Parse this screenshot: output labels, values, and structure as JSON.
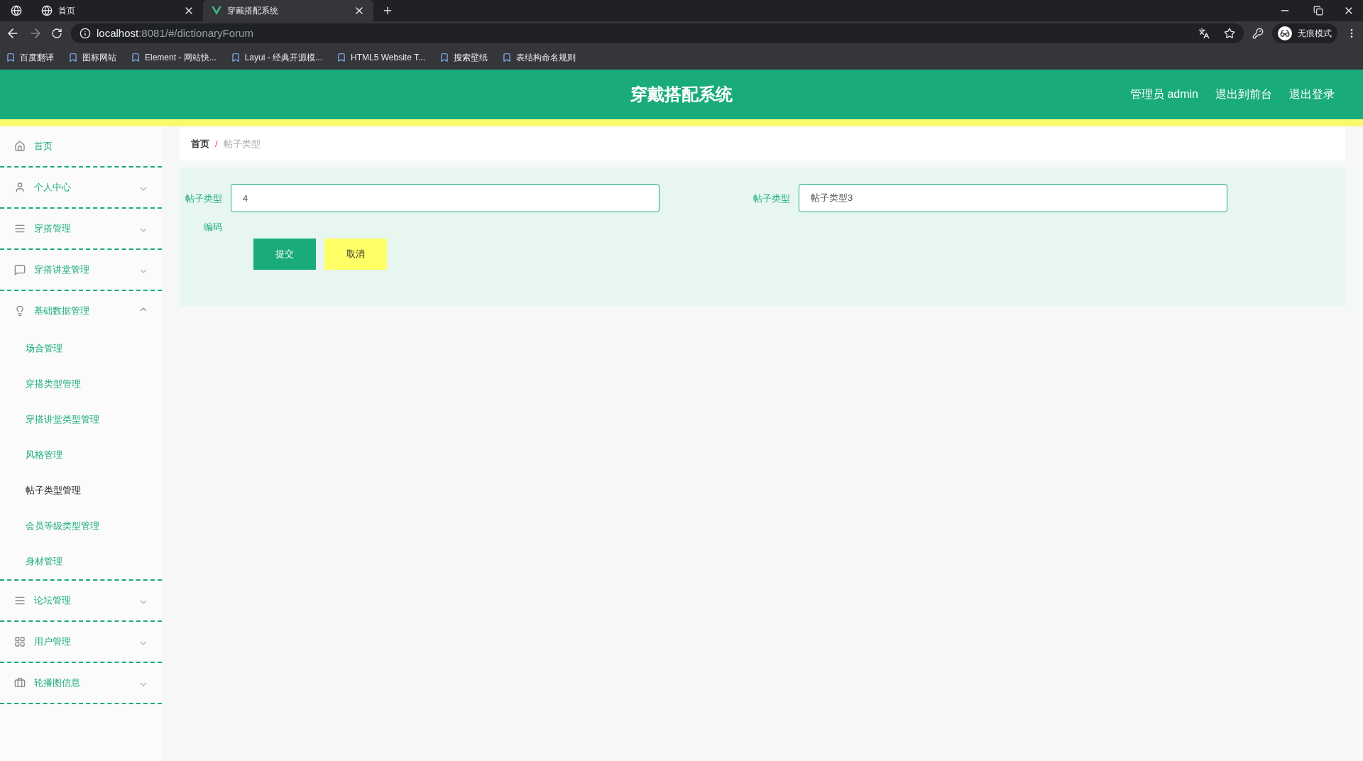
{
  "browser": {
    "tabs": [
      {
        "title": "首页",
        "selected": false
      },
      {
        "title": "穿戴搭配系统",
        "selected": true
      }
    ],
    "url_host": "localhost",
    "url_rest": ":8081/#/dictionaryForum",
    "bookmarks": [
      "百度翻译",
      "图标网站",
      "Element - 网站快...",
      "Layui - 经典开源模...",
      "HTML5 Website T...",
      "搜索壁纸",
      "表结构命名规则"
    ],
    "profile": "无痕模式"
  },
  "header": {
    "title": "穿戴搭配系统",
    "links": [
      "管理员 admin",
      "退出到前台",
      "退出登录"
    ]
  },
  "sidebar": {
    "items": [
      {
        "label": "首页",
        "kind": "link"
      },
      {
        "label": "个人中心",
        "kind": "group",
        "expanded": false
      },
      {
        "label": "穿搭管理",
        "kind": "group",
        "expanded": false
      },
      {
        "label": "穿搭讲堂管理",
        "kind": "group",
        "expanded": false
      },
      {
        "label": "基础数据管理",
        "kind": "group",
        "expanded": true,
        "children": [
          {
            "label": "场合管理",
            "selected": false
          },
          {
            "label": "穿搭类型管理",
            "selected": false
          },
          {
            "label": "穿搭讲堂类型管理",
            "selected": false
          },
          {
            "label": "风格管理",
            "selected": false
          },
          {
            "label": "帖子类型管理",
            "selected": true
          },
          {
            "label": "会员等级类型管理",
            "selected": false
          },
          {
            "label": "身材管理",
            "selected": false
          }
        ]
      },
      {
        "label": "论坛管理",
        "kind": "group",
        "expanded": false
      },
      {
        "label": "用户管理",
        "kind": "group",
        "expanded": false
      },
      {
        "label": "轮播图信息",
        "kind": "group",
        "expanded": false
      }
    ]
  },
  "breadcrumb": {
    "items": [
      "首页",
      "帖子类型"
    ],
    "separator": "/"
  },
  "form": {
    "fields": [
      {
        "label": "帖子类型编码",
        "value": "4"
      },
      {
        "label": "帖子类型",
        "value": "帖子类型3"
      }
    ],
    "buttons": [
      {
        "label": "提交",
        "kind": "primary"
      },
      {
        "label": "取消",
        "kind": "cancel"
      }
    ]
  }
}
